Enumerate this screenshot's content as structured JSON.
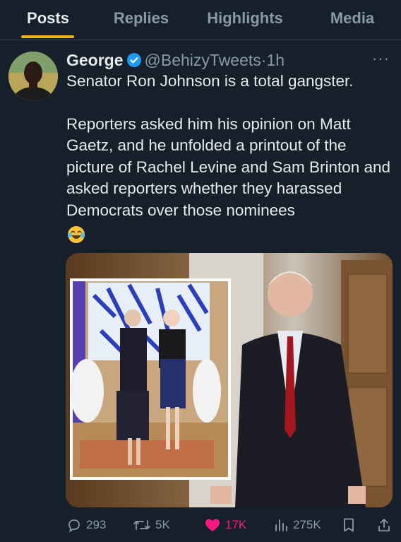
{
  "tabs": [
    {
      "label": "Posts",
      "active": true
    },
    {
      "label": "Replies",
      "active": false
    },
    {
      "label": "Highlights",
      "active": false
    },
    {
      "label": "Media",
      "active": false
    }
  ],
  "tweet": {
    "author_name": "George",
    "handle": "@BehizyTweets",
    "separator": "·",
    "time": "1h",
    "more": "···",
    "paragraph1": "Senator Ron Johnson is a total gangster.",
    "paragraph2": "Reporters asked him his opinion on Matt Gaetz, and he unfolded a printout of the picture of Rachel Levine and Sam Brinton and asked reporters whether they harassed Democrats over those nominees"
  },
  "actions": {
    "replies": "293",
    "reposts": "5K",
    "likes": "17K",
    "views": "275K"
  },
  "colors": {
    "background": "#15202b",
    "accent_tab": "#f2b118",
    "verified": "#1d9bf0",
    "like": "#f91880",
    "muted": "#8b98a5"
  }
}
